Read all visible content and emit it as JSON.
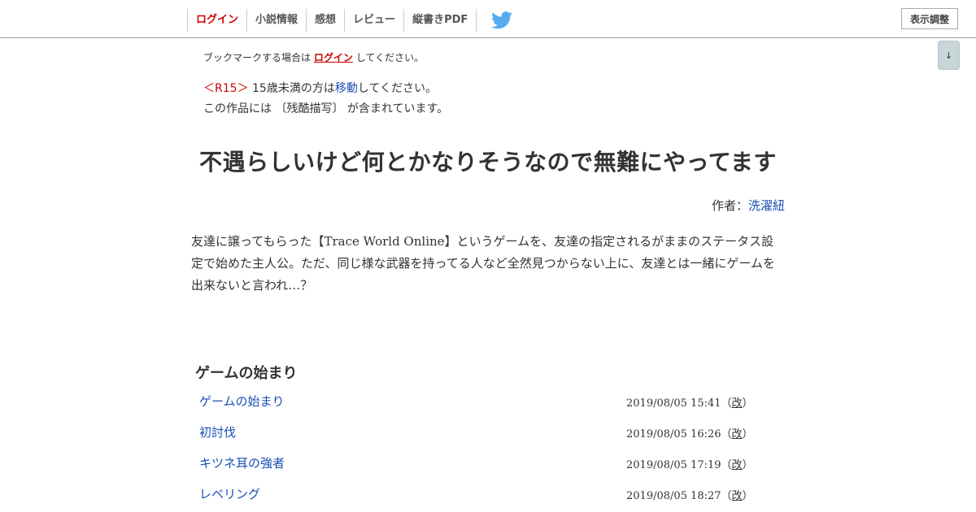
{
  "header": {
    "nav": [
      {
        "label": "ログイン"
      },
      {
        "label": "小説情報"
      },
      {
        "label": "感想"
      },
      {
        "label": "レビュー"
      },
      {
        "label": "縦書きPDF"
      }
    ],
    "twitter_icon": "twitter-bird-icon",
    "display_settings_label": "表示調整",
    "scroll_down_label": "↓"
  },
  "notice": {
    "bookmark_before": "ブックマークする場合は",
    "bookmark_link": "ログイン",
    "bookmark_after": "してください。",
    "r15_badge": "＜R15＞",
    "r15_before": "15歳未満の方は",
    "r15_link": "移動",
    "r15_after": "してください。",
    "content_warning": "この作品には 〔残酷描写〕 が含まれています。"
  },
  "novel": {
    "title": "不遇らしいけど何とかなりそうなので無難にやってます",
    "author_label": "作者：",
    "author_name": "洗濯紐",
    "synopsis": "友達に譲ってもらった【Trace World Online】というゲームを、友達の指定されるがままのステータス設定で始めた主人公。ただ、同じ様な武器を持ってる人など全然見つからない上に、友達とは一緒にゲームを出来ないと言われ…？"
  },
  "chapter": {
    "title": "ゲームの始まり",
    "episodes": [
      {
        "title": "ゲームの始まり",
        "date": "2019/08/05 15:41",
        "revised_open": "（",
        "revised_link": "改",
        "revised_close": "）"
      },
      {
        "title": "初討伐",
        "date": "2019/08/05 16:26",
        "revised_open": "（",
        "revised_link": "改",
        "revised_close": "）"
      },
      {
        "title": "キツネ耳の強者",
        "date": "2019/08/05 17:19",
        "revised_open": "（",
        "revised_link": "改",
        "revised_close": "）"
      },
      {
        "title": "レベリング",
        "date": "2019/08/05 18:27",
        "revised_open": "（",
        "revised_link": "改",
        "revised_close": "）"
      }
    ]
  },
  "colors": {
    "login_red": "#cc0000",
    "link_blue": "#1a4fb3",
    "twitter_blue": "#55acee",
    "scroll_button_bg": "#c9d6d9"
  }
}
